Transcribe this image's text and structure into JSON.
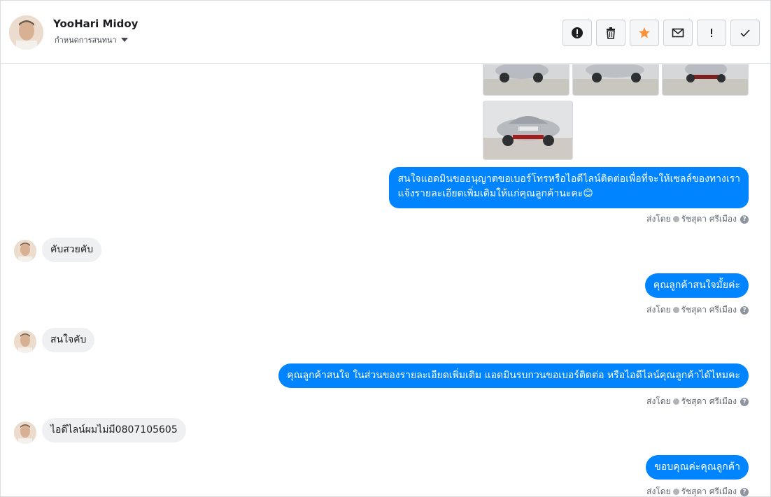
{
  "header": {
    "name": "YooHari Midoy",
    "subtitle": "กำหนดการสนทนา"
  },
  "colors": {
    "outgoing_bubble": "#0084ff",
    "incoming_bubble": "#eef0f2",
    "star": "#f7923b"
  },
  "actions": [
    {
      "name": "alert-button",
      "icon": "exclamation-circle-icon"
    },
    {
      "name": "delete-button",
      "icon": "trash-icon"
    },
    {
      "name": "star-button",
      "icon": "star-icon"
    },
    {
      "name": "mail-button",
      "icon": "envelope-icon"
    },
    {
      "name": "important-button",
      "icon": "exclamation-icon",
      "label": "!"
    },
    {
      "name": "done-button",
      "icon": "checkmark-icon"
    }
  ],
  "messages": [
    {
      "dir": "out",
      "text": "สนใจแอดมินขออนุญาตขอเบอร์โทรหรือไอดีไลน์ติดต่อเพื่อที่จะให้เซลล์ของทางเรา",
      "text2": "แจ้งรายละเอียดเพิ่มเติมให้แก่คุณลูกค้านะคะ😊"
    },
    {
      "dir": "in",
      "text": "คับสวยคับ"
    },
    {
      "dir": "out",
      "text": "คุณลูกค้าสนใจมั้ยค่ะ"
    },
    {
      "dir": "in",
      "text": "สนใจคับ"
    },
    {
      "dir": "out",
      "text": "คุณลูกค้าสนใจ ในส่วนของรายละเอียดเพิ่มเติม แอดมินรบกวนขอเบอร์ติดต่อ หรือไอดีไลน์คุณลูกค้าได้ไหมคะ"
    },
    {
      "dir": "in",
      "text": "ไอดีไลน์ผมไม่มี0807105605"
    },
    {
      "dir": "out",
      "text": "ขอบคุณค่ะคุณลูกค้า"
    }
  ],
  "sent_by": {
    "prefix": "ส่งโดย",
    "agent": "รัชสุดา ศรีเมือง",
    "help": "?"
  }
}
